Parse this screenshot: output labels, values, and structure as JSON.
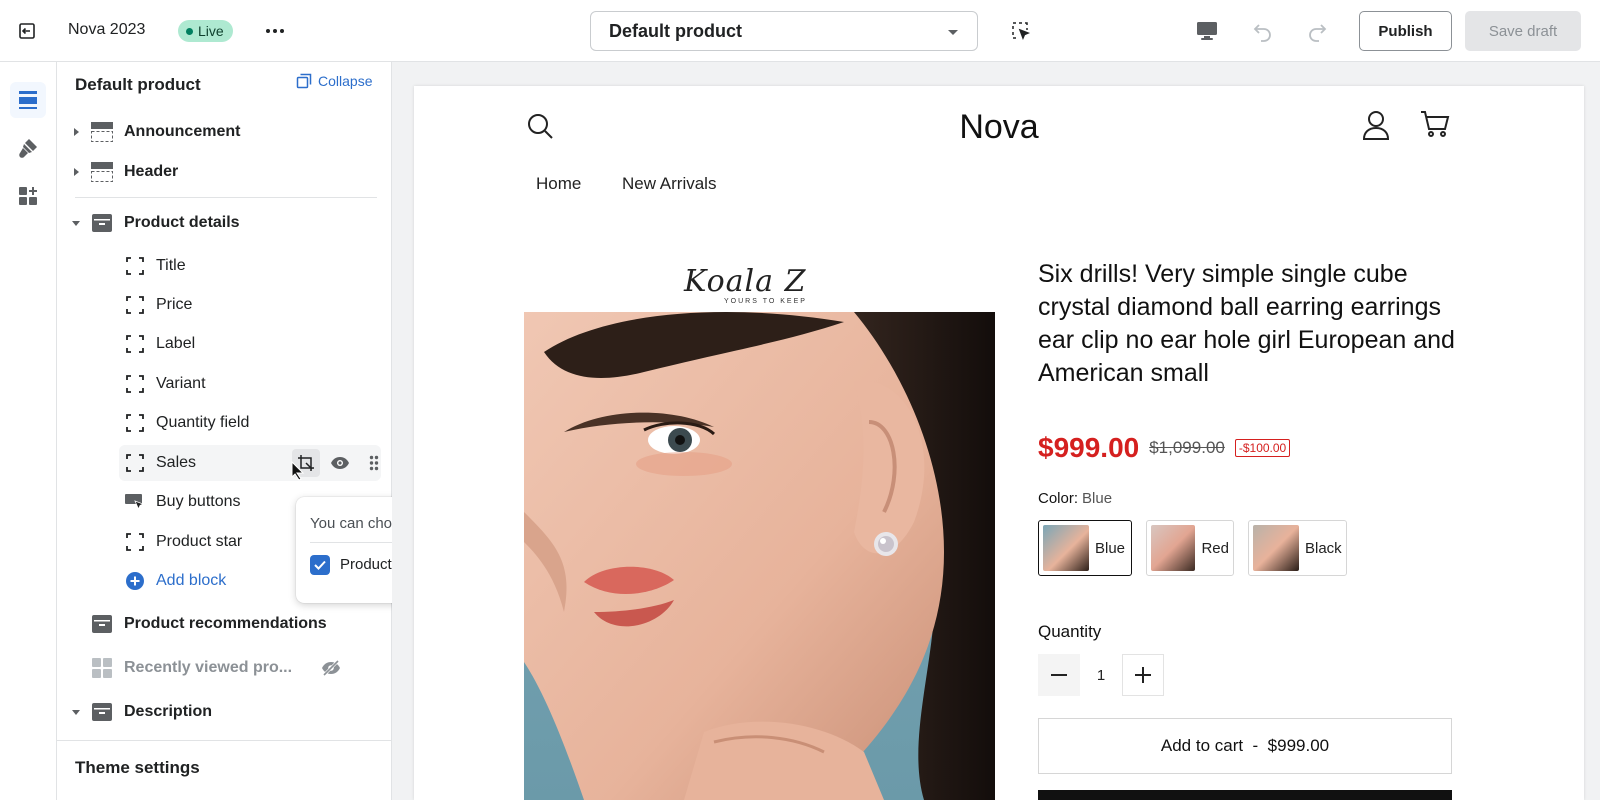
{
  "topbar": {
    "store_name": "Nova 2023",
    "status": "Live",
    "template_selected": "Default product",
    "publish_label": "Publish",
    "save_label": "Save draft"
  },
  "sidebar": {
    "title": "Default product",
    "collapse_label": "Collapse",
    "sections": {
      "announcement": "Announcement",
      "header": "Header",
      "product_details": "Product details",
      "product_recommendations": "Product recommendations",
      "recently_viewed": "Recently viewed pro...",
      "description": "Description"
    },
    "blocks": [
      "Title",
      "Price",
      "Label",
      "Variant",
      "Quantity field",
      "Sales",
      "Buy buttons",
      "Product star"
    ],
    "add_block_label": "Add block",
    "theme_settings": "Theme settings"
  },
  "popover": {
    "text": "You can choose to combine the following:",
    "option_label": "Product star",
    "option_checked": true
  },
  "preview": {
    "logo": "Nova",
    "nav": [
      "Home",
      "New Arrivals"
    ],
    "brand_script": "Koala Z",
    "brand_sub": "YOURS TO KEEP",
    "product_title": "Six drills! Very simple single cube crystal diamond ball earring earrings ear clip no ear hole girl European and American small",
    "price": "$999.00",
    "compare_price": "$1,099.00",
    "discount": "-$100.00",
    "color_label": "Color:",
    "color_value": "Blue",
    "colors": [
      "Blue",
      "Red",
      "Black"
    ],
    "quantity_label": "Quantity",
    "quantity": "1",
    "add_to_cart": "Add to cart  -  $999.00"
  },
  "colors": {
    "accent": "#2c6ecb",
    "sale": "#d5201f",
    "live_badge": "#aee9d1"
  }
}
